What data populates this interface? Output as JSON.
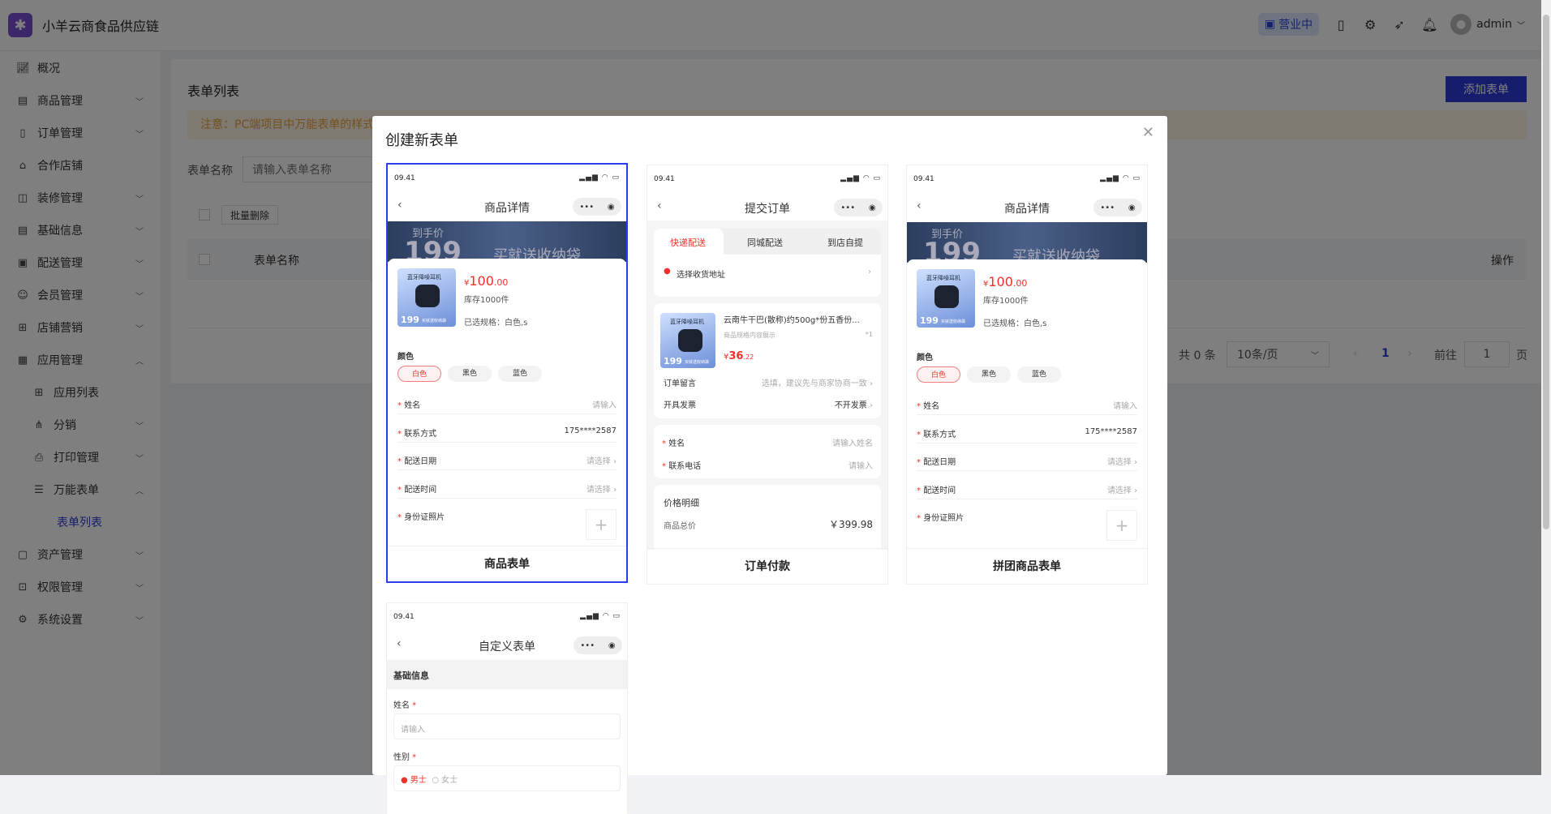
{
  "app": {
    "title": "小羊云商食品供应链",
    "logo_icon": "puzzle-icon"
  },
  "header": {
    "status_label": "营业中",
    "user": "admin"
  },
  "sidebar": {
    "items": [
      {
        "label": "概况",
        "icon": "chart-icon"
      },
      {
        "label": "商品管理",
        "icon": "product-icon"
      },
      {
        "label": "订单管理",
        "icon": "order-icon"
      },
      {
        "label": "合作店铺",
        "icon": "store-icon"
      },
      {
        "label": "装修管理",
        "icon": "decoration-icon"
      },
      {
        "label": "基础信息",
        "icon": "info-icon"
      },
      {
        "label": "配送管理",
        "icon": "delivery-icon"
      },
      {
        "label": "会员管理",
        "icon": "member-icon"
      },
      {
        "label": "店铺营销",
        "icon": "gift-icon"
      },
      {
        "label": "应用管理",
        "icon": "apps-icon"
      },
      {
        "label": "应用列表",
        "icon": "grid-icon"
      },
      {
        "label": "分销",
        "icon": "tree-icon"
      },
      {
        "label": "打印管理",
        "icon": "printer-icon"
      },
      {
        "label": "万能表单",
        "icon": "form-icon"
      },
      {
        "label": "表单列表"
      },
      {
        "label": "资产管理",
        "icon": "box-icon"
      },
      {
        "label": "权限管理",
        "icon": "lock-icon"
      },
      {
        "label": "系统设置",
        "icon": "gear-icon"
      }
    ]
  },
  "main": {
    "title": "表单列表",
    "add_button": "添加表单",
    "notice": "注意：PC端项目中万能表单的样式",
    "search_label": "表单名称",
    "search_placeholder": "请输入表单名称",
    "batch_delete": "批量删除",
    "columns": [
      "表单名称",
      "操作"
    ],
    "pagination": {
      "total": "共 0 条",
      "page_size": "10条/页",
      "current": "1",
      "goto": "前往",
      "goto_value": "1",
      "page_suffix": "页"
    }
  },
  "modal": {
    "title": "创建新表单",
    "cards": [
      {
        "label": "商品表单",
        "selected": true
      },
      {
        "label": "订单付款",
        "selected": false
      },
      {
        "label": "拼团商品表单",
        "selected": false
      },
      {
        "label": "自定义表单",
        "selected": false
      }
    ],
    "phone": {
      "time": "09.41",
      "nav_product": "商品详情",
      "nav_order": "提交订单",
      "nav_custom": "自定义表单",
      "banner": {
        "line1": "到手价",
        "price": "199",
        "slogan": "买就送收纳袋"
      },
      "product_image": {
        "title": "蓝牙降噪耳机",
        "price": "199",
        "tag": "买就送收纳袋"
      },
      "price_int": "100",
      "price_dec": ".00",
      "currency": "¥",
      "stock": "库存1000件",
      "spec": "已选规格：白色,s",
      "color_title": "颜色",
      "colors": [
        "白色",
        "黑色",
        "蓝色"
      ],
      "fields": [
        {
          "label": "姓名",
          "value": "请输入"
        },
        {
          "label": "联系方式",
          "value": "175****2587"
        },
        {
          "label": "配送日期",
          "value": "请选择"
        },
        {
          "label": "配送时间",
          "value": "请选择"
        },
        {
          "label": "身份证照片",
          "value": ""
        }
      ],
      "order": {
        "tabs": [
          "快递配送",
          "同城配送",
          "到店自提"
        ],
        "address": "选择收货地址",
        "item_name": "云南牛干巴(散称)约500g*份五香份...",
        "item_spec": "商品规格内容展示",
        "item_qty": "*1",
        "item_price_int": "36",
        "item_price_dec": ".22",
        "remark_label": "订单留言",
        "remark_value": "选填，建议先与商家协商一致",
        "invoice_label": "开具发票",
        "invoice_value": "不开发票",
        "name_label": "姓名",
        "name_placeholder": "请输入姓名",
        "phone_label": "联系电话",
        "phone_placeholder": "请输入",
        "price_title": "价格明细",
        "total_label": "商品总价",
        "total_value": "￥399.98"
      },
      "custom": {
        "section": "基础信息",
        "name_label": "姓名",
        "name_placeholder": "请输入",
        "gender_label": "性别",
        "gender_options": [
          "男士",
          "女士"
        ]
      }
    }
  },
  "colors": {
    "primary": "#2a3ad8",
    "price": "#f0302a",
    "selected_border": "#2b3cf0"
  }
}
